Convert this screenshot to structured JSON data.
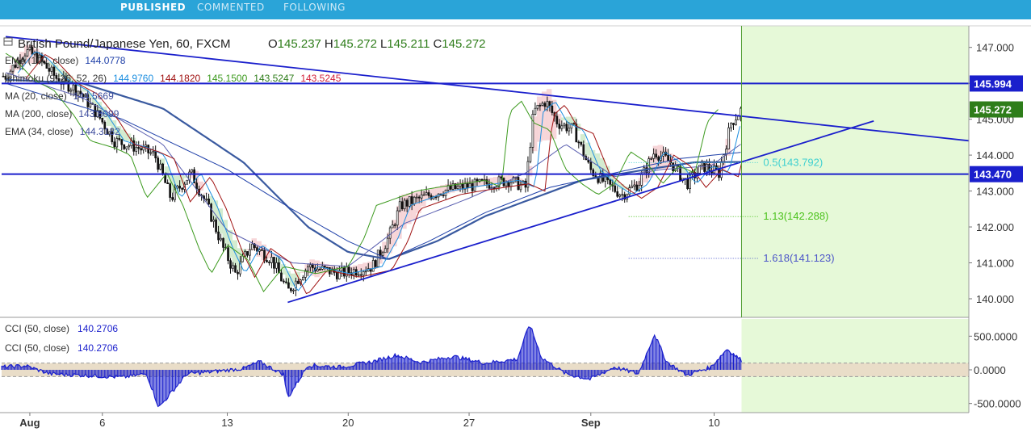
{
  "nav": {
    "tabs": [
      {
        "label": "PUBLISHED",
        "active": true
      },
      {
        "label": "COMMENTED",
        "active": false
      },
      {
        "label": "FOLLOWING",
        "active": false
      }
    ],
    "bar_color": "#2aa4d8"
  },
  "legend": {
    "symbol": "British Pound/Japanese Yen, 60, FXCM",
    "ohlc": [
      {
        "key": "O",
        "value": "145.237"
      },
      {
        "key": "H",
        "value": "145.272"
      },
      {
        "key": "L",
        "value": "145.211"
      },
      {
        "key": "C",
        "value": "145.272"
      }
    ],
    "indicators": [
      {
        "name": "EMA (100, close)",
        "values": [
          {
            "v": "144.0778",
            "color": "#1e3fa8"
          }
        ]
      },
      {
        "name": "Ichimoku (9, 26, 52, 26)",
        "values": [
          {
            "v": "144.9760",
            "color": "#1e8fe0"
          },
          {
            "v": "144.1820",
            "color": "#a01212"
          },
          {
            "v": "145.1500",
            "color": "#3c9a1e"
          },
          {
            "v": "143.5247",
            "color": "#2e7d1a"
          },
          {
            "v": "143.5245",
            "color": "#d3203a"
          }
        ]
      },
      {
        "name": "MA (20, close)",
        "values": [
          {
            "v": "144.5669",
            "color": "#3c4b9c"
          }
        ]
      },
      {
        "name": "MA (200, close)",
        "values": [
          {
            "v": "143.8099",
            "color": "#3c4b9c"
          }
        ]
      },
      {
        "name": "EMA (34, close)",
        "values": [
          {
            "v": "144.3182",
            "color": "#3c4b9c"
          }
        ]
      }
    ]
  },
  "cci_legend": [
    {
      "name": "CCI (50, close)",
      "value": "140.2706"
    },
    {
      "name": "CCI (50, close)",
      "value": "140.2706"
    }
  ],
  "colors": {
    "price_line": "#1a1fcc",
    "ma200": "#3a5aa0",
    "forecast_zone": "#e6f9d8",
    "cci_band": "#e9ddc8",
    "cci_fill": "#1a1fcc",
    "cloud_bull": "#cde9c8",
    "cloud_bear": "#f6cfd2",
    "label_bg": "#1a1fcc",
    "last_price_bg": "#2e7d1a"
  },
  "chart_data": {
    "type": "candlestick",
    "price_axis": {
      "range": [
        139.55,
        147.6
      ],
      "ticks": [
        "147.000",
        "146.000",
        "145.000",
        "144.000",
        "143.000",
        "142.000",
        "141.000",
        "140.000"
      ]
    },
    "cci_axis": {
      "range": [
        -600,
        720
      ],
      "ticks": [
        "500.0000",
        "0.0000",
        "-500.0000"
      ],
      "band": [
        -100,
        100
      ]
    },
    "x_axis": {
      "ticks": [
        "Aug",
        "6",
        "13",
        "20",
        "27",
        "Sep",
        "10"
      ],
      "bars": 1200
    },
    "horizontal_levels": [
      {
        "price": 145.994,
        "label": "145.994"
      },
      {
        "price": 143.47,
        "label": "143.470"
      }
    ],
    "last_price": {
      "price": 145.272,
      "label": "145.272"
    },
    "trend_lines": [
      {
        "from": {
          "bar": 5,
          "price": 147.3
        },
        "to": {
          "bar": 1200,
          "price": 144.4
        }
      },
      {
        "from": {
          "bar": 355,
          "price": 139.9
        },
        "to": {
          "bar": 1082,
          "price": 144.95
        }
      }
    ],
    "fibonacci_levels": [
      {
        "ratio": "0.5",
        "price": 143.792,
        "label": "0.5(143.792)",
        "color": "#3fd0d0"
      },
      {
        "ratio": "1.13",
        "price": 142.288,
        "label": "1.13(142.288)",
        "color": "#4bc21c"
      },
      {
        "ratio": "1.618",
        "price": 141.123,
        "label": "1.618(141.123)",
        "color": "#4d56c8"
      }
    ],
    "forecast_zone_start_bar": 918,
    "series_key_points": {
      "close": [
        [
          5,
          146.2
        ],
        [
          30,
          146.9
        ],
        [
          45,
          146.7
        ],
        [
          70,
          146.1
        ],
        [
          95,
          145.8
        ],
        [
          120,
          145.1
        ],
        [
          140,
          144.4
        ],
        [
          170,
          144.2
        ],
        [
          190,
          144.0
        ],
        [
          210,
          142.8
        ],
        [
          235,
          143.5
        ],
        [
          255,
          142.6
        ],
        [
          275,
          141.4
        ],
        [
          290,
          140.7
        ],
        [
          310,
          141.5
        ],
        [
          335,
          141.1
        ],
        [
          355,
          140.2
        ],
        [
          380,
          140.9
        ],
        [
          420,
          140.7
        ],
        [
          460,
          140.9
        ],
        [
          480,
          141.7
        ],
        [
          495,
          142.6
        ],
        [
          520,
          142.8
        ],
        [
          545,
          143.0
        ],
        [
          570,
          143.1
        ],
        [
          600,
          143.2
        ],
        [
          630,
          143.3
        ],
        [
          650,
          143.1
        ],
        [
          660,
          145.2
        ],
        [
          675,
          145.5
        ],
        [
          690,
          144.9
        ],
        [
          710,
          144.7
        ],
        [
          730,
          143.6
        ],
        [
          750,
          143.2
        ],
        [
          770,
          142.9
        ],
        [
          790,
          143.2
        ],
        [
          810,
          144.1
        ],
        [
          830,
          143.8
        ],
        [
          850,
          143.2
        ],
        [
          870,
          143.7
        ],
        [
          890,
          143.5
        ],
        [
          905,
          144.9
        ],
        [
          918,
          145.27
        ]
      ],
      "ema100": [
        [
          5,
          146.0
        ],
        [
          150,
          145.0
        ],
        [
          280,
          143.6
        ],
        [
          360,
          142.5
        ],
        [
          430,
          141.6
        ],
        [
          480,
          141.1
        ],
        [
          530,
          141.6
        ],
        [
          600,
          142.4
        ],
        [
          680,
          143.1
        ],
        [
          760,
          143.5
        ],
        [
          840,
          143.9
        ],
        [
          918,
          144.08
        ]
      ],
      "ma200": [
        [
          5,
          146.1
        ],
        [
          100,
          146.0
        ],
        [
          200,
          145.3
        ],
        [
          300,
          143.8
        ],
        [
          380,
          142.0
        ],
        [
          430,
          141.3
        ],
        [
          480,
          141.1
        ],
        [
          540,
          141.6
        ],
        [
          600,
          142.3
        ],
        [
          660,
          142.8
        ],
        [
          720,
          143.3
        ],
        [
          800,
          143.6
        ],
        [
          860,
          143.8
        ],
        [
          918,
          143.81
        ]
      ],
      "ema34": [
        [
          5,
          146.3
        ],
        [
          100,
          145.6
        ],
        [
          200,
          144.3
        ],
        [
          280,
          141.9
        ],
        [
          360,
          141.0
        ],
        [
          430,
          140.9
        ],
        [
          500,
          142.1
        ],
        [
          580,
          142.8
        ],
        [
          650,
          143.5
        ],
        [
          700,
          144.3
        ],
        [
          760,
          143.4
        ],
        [
          820,
          143.6
        ],
        [
          880,
          143.7
        ],
        [
          918,
          144.32
        ]
      ],
      "cci": [
        [
          0,
          40
        ],
        [
          30,
          60
        ],
        [
          60,
          -60
        ],
        [
          100,
          -80
        ],
        [
          150,
          -110
        ],
        [
          180,
          -60
        ],
        [
          195,
          -560
        ],
        [
          230,
          -60
        ],
        [
          260,
          -30
        ],
        [
          300,
          20
        ],
        [
          320,
          120
        ],
        [
          350,
          -70
        ],
        [
          355,
          -420
        ],
        [
          380,
          70
        ],
        [
          420,
          40
        ],
        [
          460,
          120
        ],
        [
          490,
          220
        ],
        [
          520,
          110
        ],
        [
          560,
          200
        ],
        [
          600,
          100
        ],
        [
          640,
          160
        ],
        [
          655,
          680
        ],
        [
          670,
          180
        ],
        [
          700,
          -60
        ],
        [
          730,
          -140
        ],
        [
          760,
          40
        ],
        [
          790,
          -60
        ],
        [
          810,
          530
        ],
        [
          825,
          120
        ],
        [
          850,
          -80
        ],
        [
          880,
          40
        ],
        [
          900,
          310
        ],
        [
          918,
          140
        ]
      ]
    }
  }
}
